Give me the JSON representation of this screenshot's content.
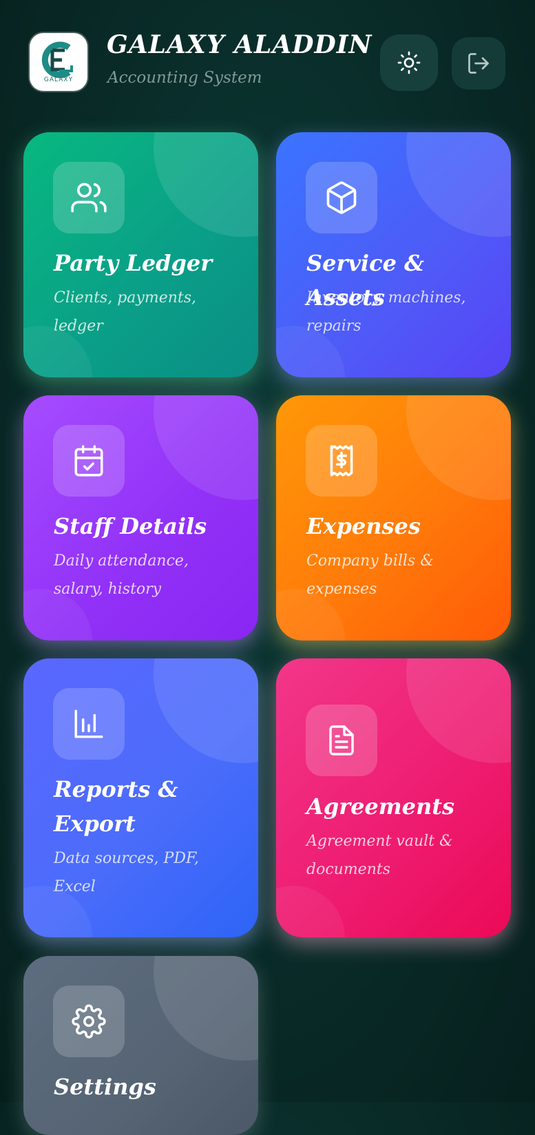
{
  "header": {
    "logo": {
      "icon": "galaxy-logo",
      "text": "GALAXY"
    },
    "title": "GALAXY ALADDIN",
    "subtitle": "Accounting System",
    "theme_button_icon": "sun-icon",
    "logout_button_icon": "logout-icon"
  },
  "cards": [
    {
      "id": "party-ledger",
      "title": "Party Ledger",
      "description": "Clients, payments, ledger",
      "icon": "users-icon",
      "color": "#0aa088"
    },
    {
      "id": "service-assets",
      "title": "Service & Assets",
      "description": "Inventory, machines, repairs",
      "icon": "box-icon",
      "color": "#4f5af7"
    },
    {
      "id": "staff-details",
      "title": "Staff Details",
      "description": "Daily attendance, salary, history",
      "icon": "calendar-check-icon",
      "color": "#9130f7"
    },
    {
      "id": "expenses",
      "title": "Expenses",
      "description": "Company bills & expenses",
      "icon": "receipt-dollar-icon",
      "color": "#ff7a0a"
    },
    {
      "id": "reports-export",
      "title": "Reports & Export",
      "description": "Data sources, PDF, Excel",
      "icon": "bar-chart-icon",
      "color": "#4b6cfb"
    },
    {
      "id": "agreements",
      "title": "Agreements",
      "description": "Agreement vault & documents",
      "icon": "document-icon",
      "color": "#ee1d72"
    },
    {
      "id": "settings",
      "title": "Settings",
      "description": "",
      "icon": "gear-icon",
      "color": "#566474"
    }
  ]
}
